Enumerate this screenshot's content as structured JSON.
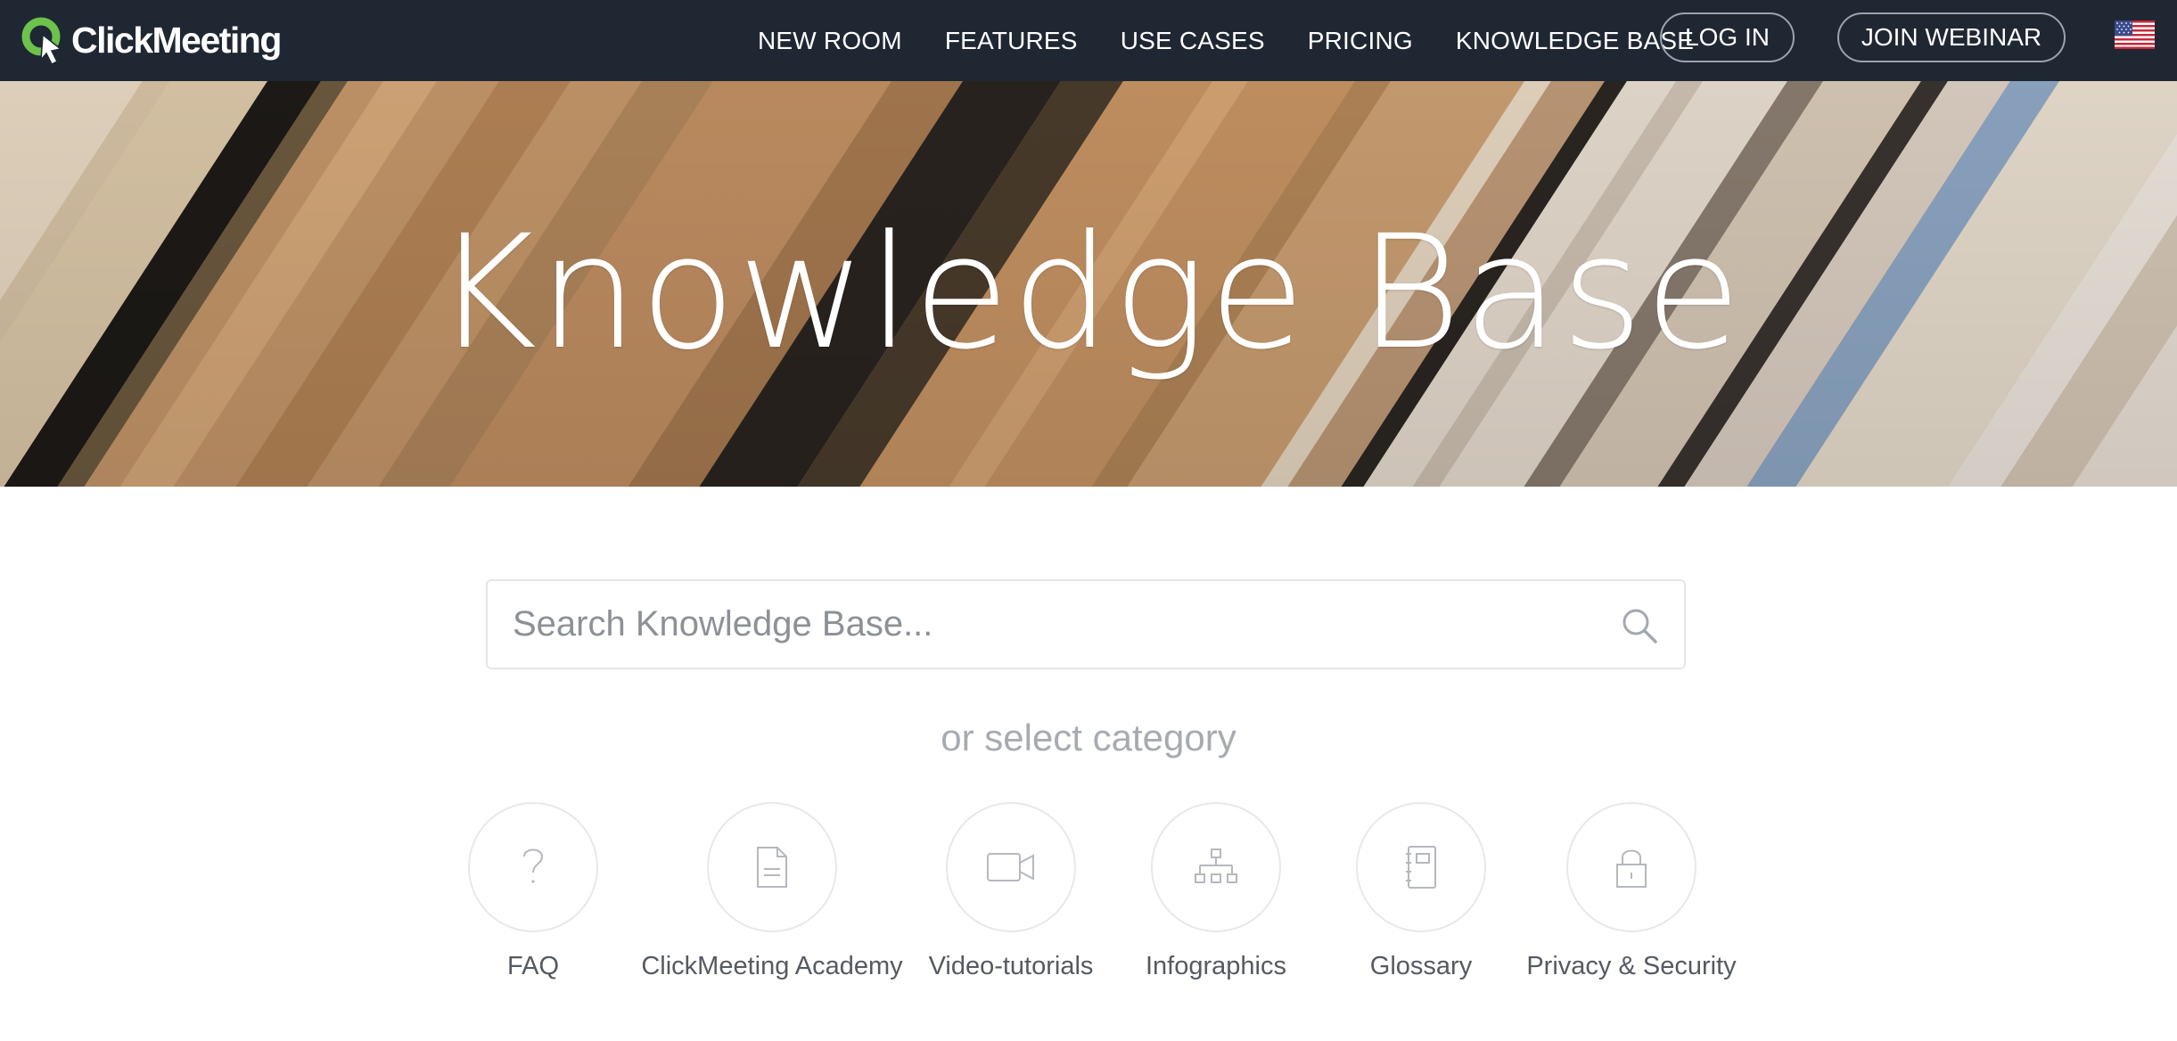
{
  "brand": {
    "name": "ClickMeeting",
    "accent": "#6cc24a",
    "header_bg": "#1f2733"
  },
  "nav": {
    "links": [
      "NEW ROOM",
      "FEATURES",
      "USE CASES",
      "PRICING",
      "KNOWLEDGE BASE"
    ],
    "login": "LOG IN",
    "join": "JOIN WEBINAR",
    "language_icon": "us-flag-icon"
  },
  "hero": {
    "title": "Knowledge Base"
  },
  "search": {
    "placeholder": "Search Knowledge Base..."
  },
  "categories_prompt": "or select category",
  "categories": [
    {
      "label": "FAQ",
      "icon": "question-icon"
    },
    {
      "label": "ClickMeeting Academy",
      "icon": "document-icon"
    },
    {
      "label": "Video-tutorials",
      "icon": "video-camera-icon"
    },
    {
      "label": "Infographics",
      "icon": "org-chart-icon"
    },
    {
      "label": "Glossary",
      "icon": "notebook-icon"
    },
    {
      "label": "Privacy & Security",
      "icon": "lock-icon"
    }
  ]
}
